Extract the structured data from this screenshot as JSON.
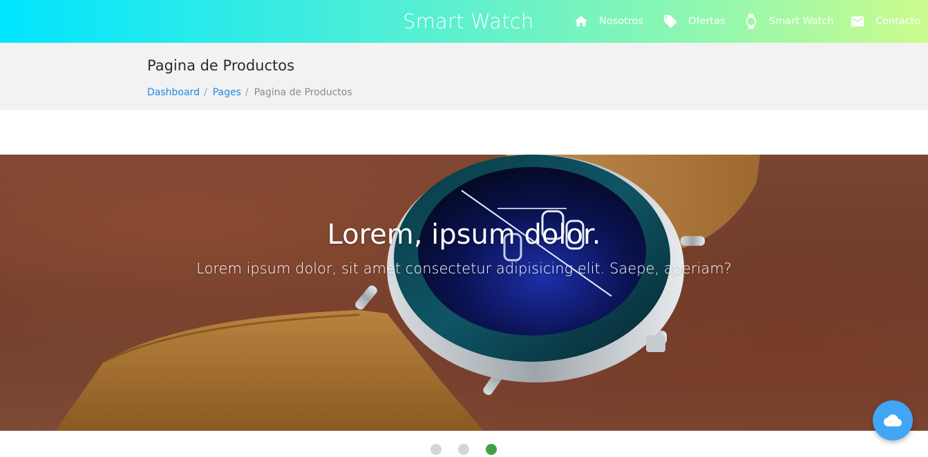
{
  "navbar": {
    "brand": "Smart Watch",
    "items": [
      {
        "label": "Nosotros",
        "icon": "home-icon"
      },
      {
        "label": "Ofertas",
        "icon": "tag-icon"
      },
      {
        "label": "Smart Watch",
        "icon": "watch-icon"
      },
      {
        "label": "Contacto",
        "icon": "mail-icon"
      }
    ],
    "gradient_colors": [
      "#00e5ff",
      "#ccfb8d"
    ]
  },
  "header": {
    "title": "Pagina de Productos",
    "breadcrumb": [
      {
        "label": "Dashboard"
      },
      {
        "label": "Pages"
      },
      {
        "label": "Pagina de Productos"
      }
    ]
  },
  "carousel": {
    "slide": {
      "title": "Lorem, ipsum dolor.",
      "text": "Lorem ipsum dolor, sit amet consectetur adipisicing elit. Saepe, aperiam?"
    },
    "indicator_count": 3,
    "active_index": 2,
    "active_color": "#43a047"
  },
  "fab": {
    "icon": "cloud-icon",
    "color": "#42a5f5"
  }
}
